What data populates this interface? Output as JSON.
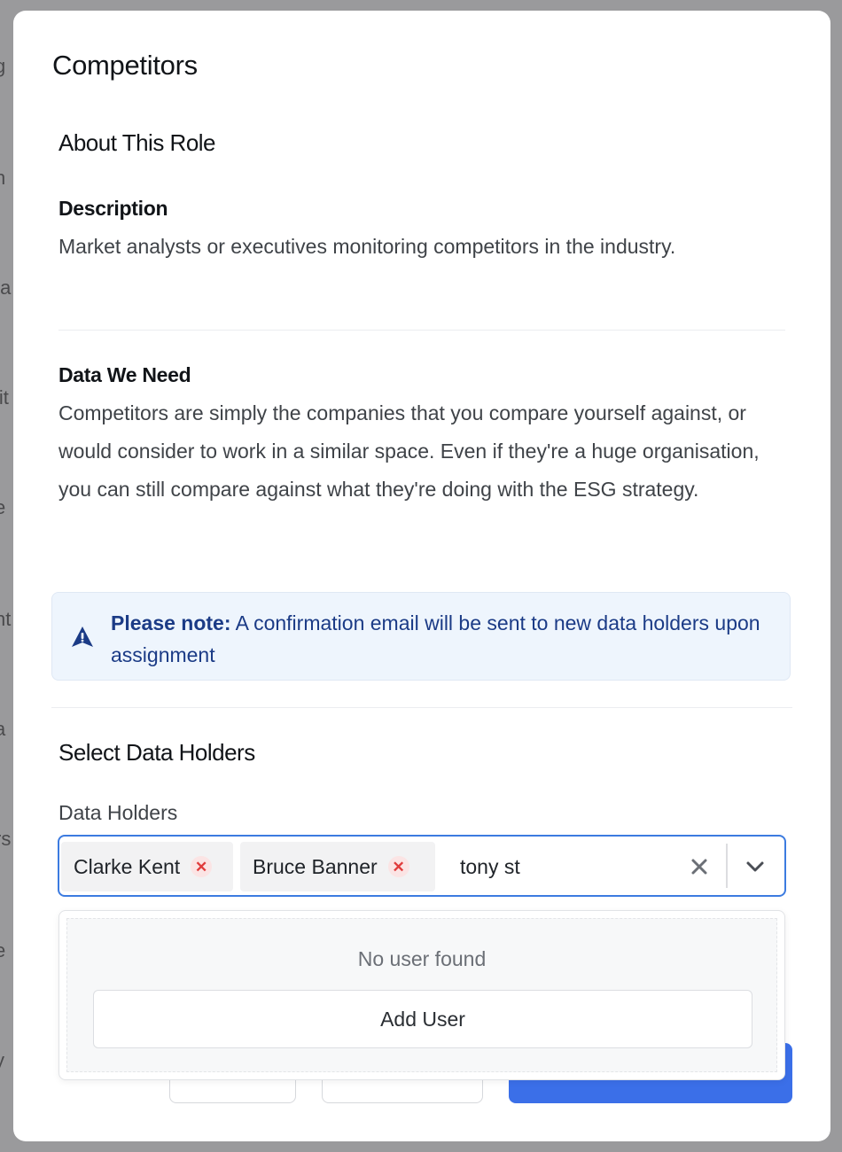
{
  "modal": {
    "title": "Competitors",
    "about": {
      "heading": "About This Role",
      "description_label": "Description",
      "description_text": "Market analysts or executives monitoring competitors in the industry.",
      "data_label": "Data We Need",
      "data_text": "Competitors are simply the companies that you compare yourself against, or would consider to work in a similar space. Even if they're a huge organisation, you can still compare against what they're doing with the ESG strategy."
    },
    "notice": {
      "icon": "warning-triangle-icon",
      "bold": "Please note:",
      "text": " A confirmation email will be sent to new data holders upon assignment"
    },
    "holders": {
      "heading": "Select Data Holders",
      "field_label": "Data Holders",
      "selected": [
        {
          "name": "Clarke Kent"
        },
        {
          "name": "Bruce Banner"
        }
      ],
      "search_value": "tony st",
      "dropdown": {
        "empty_text": "No user found",
        "add_button": "Add User"
      }
    }
  },
  "colors": {
    "accent": "#3c7be0",
    "primary_button": "#3b6fe8",
    "notice_bg": "#eef5fd",
    "notice_text": "#1b3b86",
    "remove_chip": "#e03b3b"
  }
}
